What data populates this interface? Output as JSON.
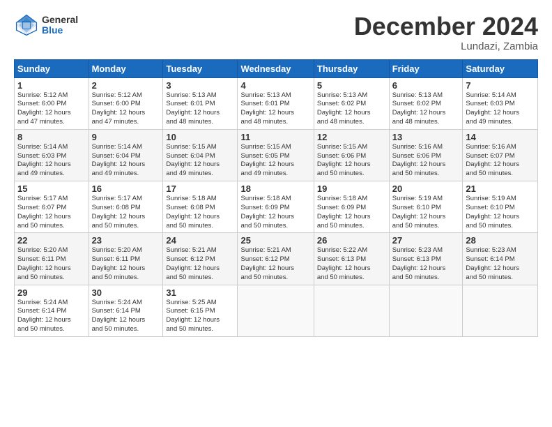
{
  "header": {
    "logo_general": "General",
    "logo_blue": "Blue",
    "month_title": "December 2024",
    "location": "Lundazi, Zambia"
  },
  "days_of_week": [
    "Sunday",
    "Monday",
    "Tuesday",
    "Wednesday",
    "Thursday",
    "Friday",
    "Saturday"
  ],
  "weeks": [
    [
      {
        "day": "1",
        "info": "Sunrise: 5:12 AM\nSunset: 6:00 PM\nDaylight: 12 hours\nand 47 minutes."
      },
      {
        "day": "2",
        "info": "Sunrise: 5:12 AM\nSunset: 6:00 PM\nDaylight: 12 hours\nand 47 minutes."
      },
      {
        "day": "3",
        "info": "Sunrise: 5:13 AM\nSunset: 6:01 PM\nDaylight: 12 hours\nand 48 minutes."
      },
      {
        "day": "4",
        "info": "Sunrise: 5:13 AM\nSunset: 6:01 PM\nDaylight: 12 hours\nand 48 minutes."
      },
      {
        "day": "5",
        "info": "Sunrise: 5:13 AM\nSunset: 6:02 PM\nDaylight: 12 hours\nand 48 minutes."
      },
      {
        "day": "6",
        "info": "Sunrise: 5:13 AM\nSunset: 6:02 PM\nDaylight: 12 hours\nand 48 minutes."
      },
      {
        "day": "7",
        "info": "Sunrise: 5:14 AM\nSunset: 6:03 PM\nDaylight: 12 hours\nand 49 minutes."
      }
    ],
    [
      {
        "day": "8",
        "info": "Sunrise: 5:14 AM\nSunset: 6:03 PM\nDaylight: 12 hours\nand 49 minutes."
      },
      {
        "day": "9",
        "info": "Sunrise: 5:14 AM\nSunset: 6:04 PM\nDaylight: 12 hours\nand 49 minutes."
      },
      {
        "day": "10",
        "info": "Sunrise: 5:15 AM\nSunset: 6:04 PM\nDaylight: 12 hours\nand 49 minutes."
      },
      {
        "day": "11",
        "info": "Sunrise: 5:15 AM\nSunset: 6:05 PM\nDaylight: 12 hours\nand 49 minutes."
      },
      {
        "day": "12",
        "info": "Sunrise: 5:15 AM\nSunset: 6:06 PM\nDaylight: 12 hours\nand 50 minutes."
      },
      {
        "day": "13",
        "info": "Sunrise: 5:16 AM\nSunset: 6:06 PM\nDaylight: 12 hours\nand 50 minutes."
      },
      {
        "day": "14",
        "info": "Sunrise: 5:16 AM\nSunset: 6:07 PM\nDaylight: 12 hours\nand 50 minutes."
      }
    ],
    [
      {
        "day": "15",
        "info": "Sunrise: 5:17 AM\nSunset: 6:07 PM\nDaylight: 12 hours\nand 50 minutes."
      },
      {
        "day": "16",
        "info": "Sunrise: 5:17 AM\nSunset: 6:08 PM\nDaylight: 12 hours\nand 50 minutes."
      },
      {
        "day": "17",
        "info": "Sunrise: 5:18 AM\nSunset: 6:08 PM\nDaylight: 12 hours\nand 50 minutes."
      },
      {
        "day": "18",
        "info": "Sunrise: 5:18 AM\nSunset: 6:09 PM\nDaylight: 12 hours\nand 50 minutes."
      },
      {
        "day": "19",
        "info": "Sunrise: 5:18 AM\nSunset: 6:09 PM\nDaylight: 12 hours\nand 50 minutes."
      },
      {
        "day": "20",
        "info": "Sunrise: 5:19 AM\nSunset: 6:10 PM\nDaylight: 12 hours\nand 50 minutes."
      },
      {
        "day": "21",
        "info": "Sunrise: 5:19 AM\nSunset: 6:10 PM\nDaylight: 12 hours\nand 50 minutes."
      }
    ],
    [
      {
        "day": "22",
        "info": "Sunrise: 5:20 AM\nSunset: 6:11 PM\nDaylight: 12 hours\nand 50 minutes."
      },
      {
        "day": "23",
        "info": "Sunrise: 5:20 AM\nSunset: 6:11 PM\nDaylight: 12 hours\nand 50 minutes."
      },
      {
        "day": "24",
        "info": "Sunrise: 5:21 AM\nSunset: 6:12 PM\nDaylight: 12 hours\nand 50 minutes."
      },
      {
        "day": "25",
        "info": "Sunrise: 5:21 AM\nSunset: 6:12 PM\nDaylight: 12 hours\nand 50 minutes."
      },
      {
        "day": "26",
        "info": "Sunrise: 5:22 AM\nSunset: 6:13 PM\nDaylight: 12 hours\nand 50 minutes."
      },
      {
        "day": "27",
        "info": "Sunrise: 5:23 AM\nSunset: 6:13 PM\nDaylight: 12 hours\nand 50 minutes."
      },
      {
        "day": "28",
        "info": "Sunrise: 5:23 AM\nSunset: 6:14 PM\nDaylight: 12 hours\nand 50 minutes."
      }
    ],
    [
      {
        "day": "29",
        "info": "Sunrise: 5:24 AM\nSunset: 6:14 PM\nDaylight: 12 hours\nand 50 minutes."
      },
      {
        "day": "30",
        "info": "Sunrise: 5:24 AM\nSunset: 6:14 PM\nDaylight: 12 hours\nand 50 minutes."
      },
      {
        "day": "31",
        "info": "Sunrise: 5:25 AM\nSunset: 6:15 PM\nDaylight: 12 hours\nand 50 minutes."
      },
      {
        "day": "",
        "info": ""
      },
      {
        "day": "",
        "info": ""
      },
      {
        "day": "",
        "info": ""
      },
      {
        "day": "",
        "info": ""
      }
    ]
  ]
}
